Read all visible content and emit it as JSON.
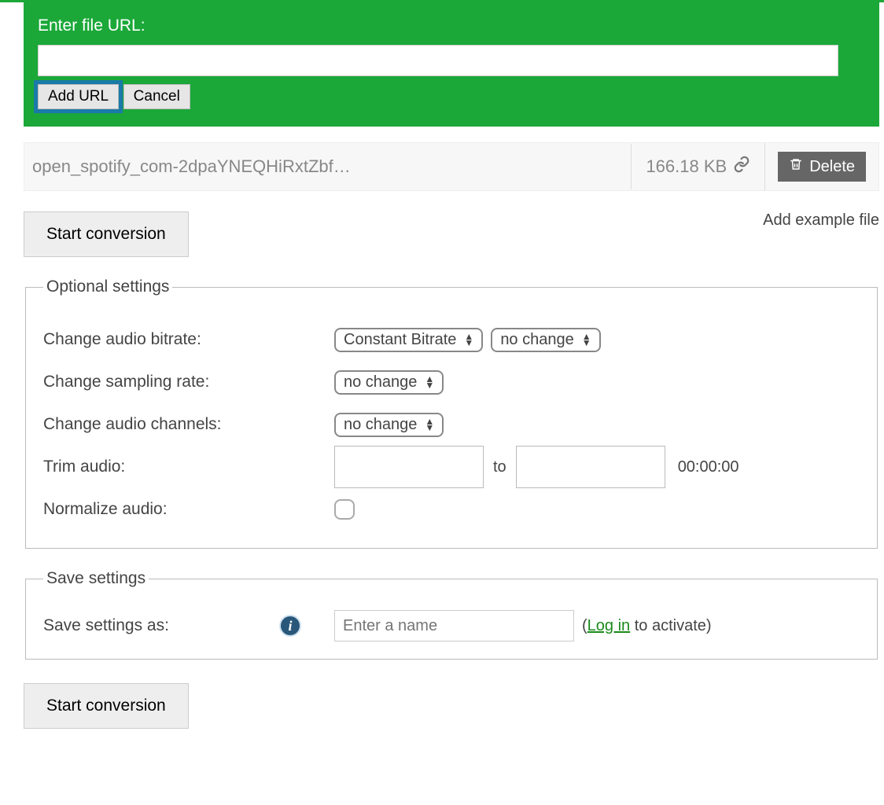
{
  "url_panel": {
    "label": "Enter file URL:",
    "value": "",
    "add_btn": "Add URL",
    "cancel_btn": "Cancel"
  },
  "file": {
    "name": "open_spotify_com-2dpaYNEQHiRxtZbf…",
    "size": "166.18 KB",
    "delete_label": "Delete"
  },
  "start_label": "Start conversion",
  "example_link": "Add example file",
  "optional": {
    "legend": "Optional settings",
    "bitrate_label": "Change audio bitrate:",
    "bitrate_mode": "Constant Bitrate",
    "bitrate_value": "no change",
    "sampling_label": "Change sampling rate:",
    "sampling_value": "no change",
    "channels_label": "Change audio channels:",
    "channels_value": "no change",
    "trim_label": "Trim audio:",
    "trim_to": "to",
    "trim_duration": "00:00:00",
    "normalize_label": "Normalize audio:"
  },
  "save": {
    "legend": "Save settings",
    "label": "Save settings as:",
    "placeholder": "Enter a name",
    "login_pre": "(",
    "login_text": "Log in",
    "login_post": " to activate)"
  }
}
